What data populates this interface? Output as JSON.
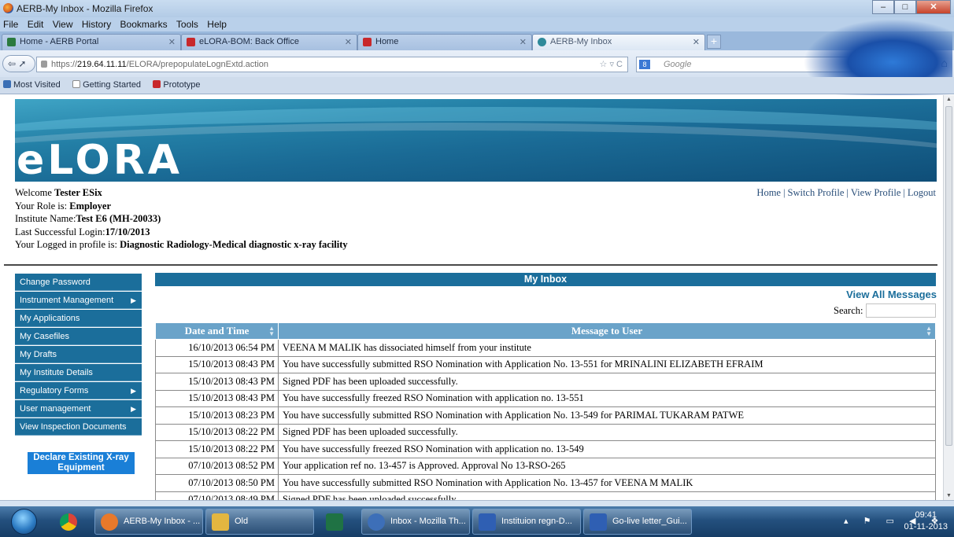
{
  "window": {
    "title": "AERB-My Inbox - Mozilla Firefox"
  },
  "menu": [
    "File",
    "Edit",
    "View",
    "History",
    "Bookmarks",
    "Tools",
    "Help"
  ],
  "tabs": [
    {
      "label": "Home - AERB Portal",
      "icon_color": "#2b7a3f"
    },
    {
      "label": "eLORA-BOM: Back Office",
      "icon_color": "#c8282b"
    },
    {
      "label": "Home",
      "icon_color": "#c8282b"
    },
    {
      "label": "AERB-My Inbox",
      "icon_color": "#2f8a9a"
    }
  ],
  "urlbar": {
    "prefix": "https://",
    "host": "219.64.11.11",
    "path": "/ELORA/prepopulateLognExtd.action"
  },
  "searchbar": {
    "placeholder": "Google",
    "engine_label": "8"
  },
  "bookmarks": [
    "Most Visited",
    "Getting Started",
    "Prototype"
  ],
  "page": {
    "logo": "eLORA",
    "welcome": {
      "line1_label": "Welcome ",
      "user": "Tester ESix",
      "line2_label": "Your Role is: ",
      "role": "Employer",
      "line3_label": "Institute Name:",
      "institute": "Test E6 (MH-20033)",
      "line4_label": "Last Successful Login:",
      "last_login": "17/10/2013",
      "line5_label": "Your Logged in profile is: ",
      "profile": "Diagnostic Radiology-Medical diagnostic x-ray facility"
    },
    "top_links": [
      "Home",
      "Switch Profile",
      "View Profile",
      "Logout"
    ],
    "side_menu": [
      {
        "label": "Change Password",
        "has_submenu": false
      },
      {
        "label": "Instrument Management",
        "has_submenu": true
      },
      {
        "label": "My Applications",
        "has_submenu": false
      },
      {
        "label": "My Casefiles",
        "has_submenu": false
      },
      {
        "label": "My Drafts",
        "has_submenu": false
      },
      {
        "label": "My Institute Details",
        "has_submenu": false
      },
      {
        "label": "Regulatory Forms",
        "has_submenu": true
      },
      {
        "label": "User management",
        "has_submenu": true
      },
      {
        "label": "View Inspection Documents",
        "has_submenu": false
      }
    ],
    "declare_button": "Declare Existing X-ray Equipment",
    "inbox": {
      "title": "My Inbox",
      "view_all": "View All Messages",
      "search_label": "Search:",
      "search_value": "",
      "columns": [
        "Date and Time",
        "Message to User"
      ],
      "rows": [
        [
          "16/10/2013 06:54 PM",
          "VEENA M MALIK has dissociated himself from your institute"
        ],
        [
          "15/10/2013 08:43 PM",
          "You have successfully submitted RSO Nomination with Application No. 13-551 for MRINALINI ELIZABETH EFRAIM"
        ],
        [
          "15/10/2013 08:43 PM",
          "Signed PDF has been uploaded successfully."
        ],
        [
          "15/10/2013 08:43 PM",
          "You have successfully freezed RSO Nomination with application no. 13-551"
        ],
        [
          "15/10/2013 08:23 PM",
          "You have successfully submitted RSO Nomination with Application No. 13-549 for PARIMAL TUKARAM PATWE"
        ],
        [
          "15/10/2013 08:22 PM",
          "Signed PDF has been uploaded successfully."
        ],
        [
          "15/10/2013 08:22 PM",
          "You have successfully freezed RSO Nomination with application no. 13-549"
        ],
        [
          "07/10/2013 08:52 PM",
          "Your application ref no. 13-457 is Approved. Approval No 13-RSO-265"
        ],
        [
          "07/10/2013 08:50 PM",
          "You have successfully submitted RSO Nomination with Application No. 13-457 for VEENA M MALIK"
        ],
        [
          "07/10/2013 08:49 PM",
          "Signed PDF has been uploaded successfully."
        ]
      ]
    }
  },
  "taskbar": {
    "tasks": [
      {
        "label": "AERB-My Inbox - ...",
        "icon_color": "#e8792b"
      },
      {
        "label": "Old",
        "icon_color": "#e3b640"
      },
      {
        "label": "Inbox - Mozilla Th...",
        "icon_color": "#3d6fb8"
      },
      {
        "label": "Instituion regn-D...",
        "icon_color": "#2f5fb3"
      },
      {
        "label": "Go-live letter_Gui...",
        "icon_color": "#2f5fb3"
      }
    ],
    "time": "09:41",
    "date": "01-11-2013"
  }
}
